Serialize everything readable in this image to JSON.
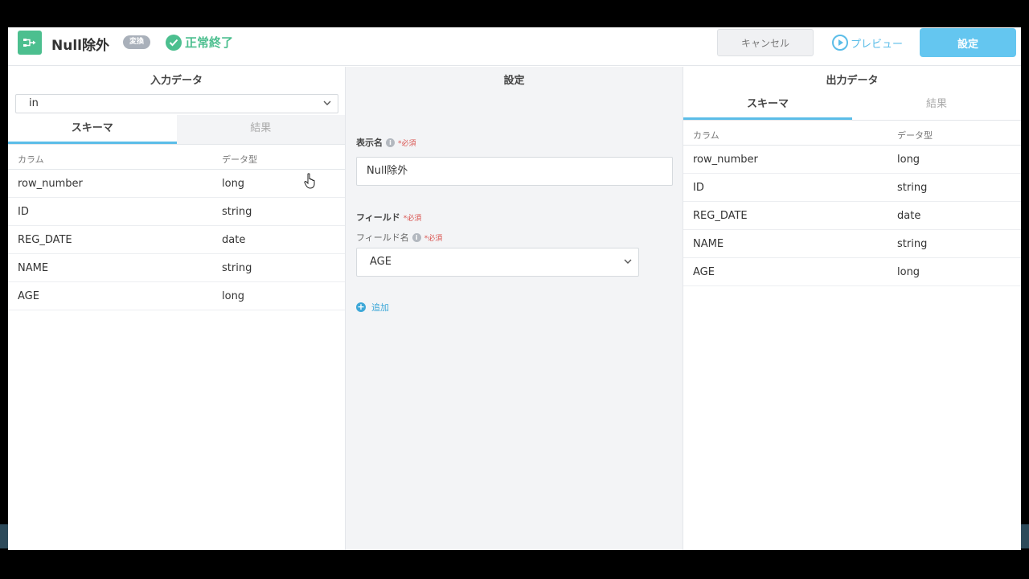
{
  "header": {
    "title": "Null除外",
    "badge": "変換",
    "status": "正常終了",
    "cancel_label": "キャンセル",
    "preview_label": "プレビュー",
    "set_label": "設定"
  },
  "input_panel": {
    "title": "入力データ",
    "selected_input": "in",
    "tabs": [
      {
        "label": "スキーマ",
        "active": true
      },
      {
        "label": "結果",
        "active": false
      }
    ],
    "columns": [
      "カラム",
      "データ型"
    ],
    "rows": [
      {
        "name": "row_number",
        "type": "long"
      },
      {
        "name": "ID",
        "type": "string"
      },
      {
        "name": "REG_DATE",
        "type": "date"
      },
      {
        "name": "NAME",
        "type": "string"
      },
      {
        "name": "AGE",
        "type": "long"
      }
    ]
  },
  "settings_panel": {
    "title": "設定",
    "display_name_label": "表示名",
    "required_label": "*必須",
    "display_name_value": "Null除外",
    "field_section_label": "フィールド",
    "field_name_label": "フィールド名",
    "field_value": "AGE",
    "add_label": "追加"
  },
  "output_panel": {
    "title": "出力データ",
    "tabs": [
      {
        "label": "スキーマ",
        "active": true
      },
      {
        "label": "結果",
        "active": false
      }
    ],
    "columns": [
      "カラム",
      "データ型"
    ],
    "rows": [
      {
        "name": "row_number",
        "type": "long"
      },
      {
        "name": "ID",
        "type": "string"
      },
      {
        "name": "REG_DATE",
        "type": "date"
      },
      {
        "name": "NAME",
        "type": "string"
      },
      {
        "name": "AGE",
        "type": "long"
      }
    ]
  },
  "colors": {
    "accent": "#5bbde8",
    "success": "#4cbf8f",
    "required": "#d9534f"
  }
}
